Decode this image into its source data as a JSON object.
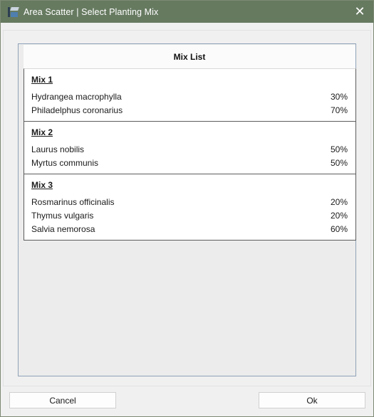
{
  "window": {
    "title": "Area Scatter | Select Planting Mix",
    "close_symbol": "✕",
    "app_icon": "vectorworks-app-icon",
    "titlebar_color": "#667a60"
  },
  "list": {
    "header": "Mix List",
    "mixes": [
      {
        "title": "Mix 1",
        "plants": [
          {
            "name": "Hydrangea macrophylla",
            "percent": "30%"
          },
          {
            "name": "Philadelphus coronarius",
            "percent": "70%"
          }
        ]
      },
      {
        "title": "Mix 2",
        "plants": [
          {
            "name": "Laurus nobilis",
            "percent": "50%"
          },
          {
            "name": "Myrtus communis",
            "percent": "50%"
          }
        ]
      },
      {
        "title": "Mix 3",
        "plants": [
          {
            "name": "Rosmarinus officinalis",
            "percent": "20%"
          },
          {
            "name": "Thymus vulgaris",
            "percent": "20%"
          },
          {
            "name": "Salvia nemorosa",
            "percent": "60%"
          }
        ]
      }
    ]
  },
  "buttons": {
    "cancel_label": "Cancel",
    "ok_label": "Ok"
  }
}
